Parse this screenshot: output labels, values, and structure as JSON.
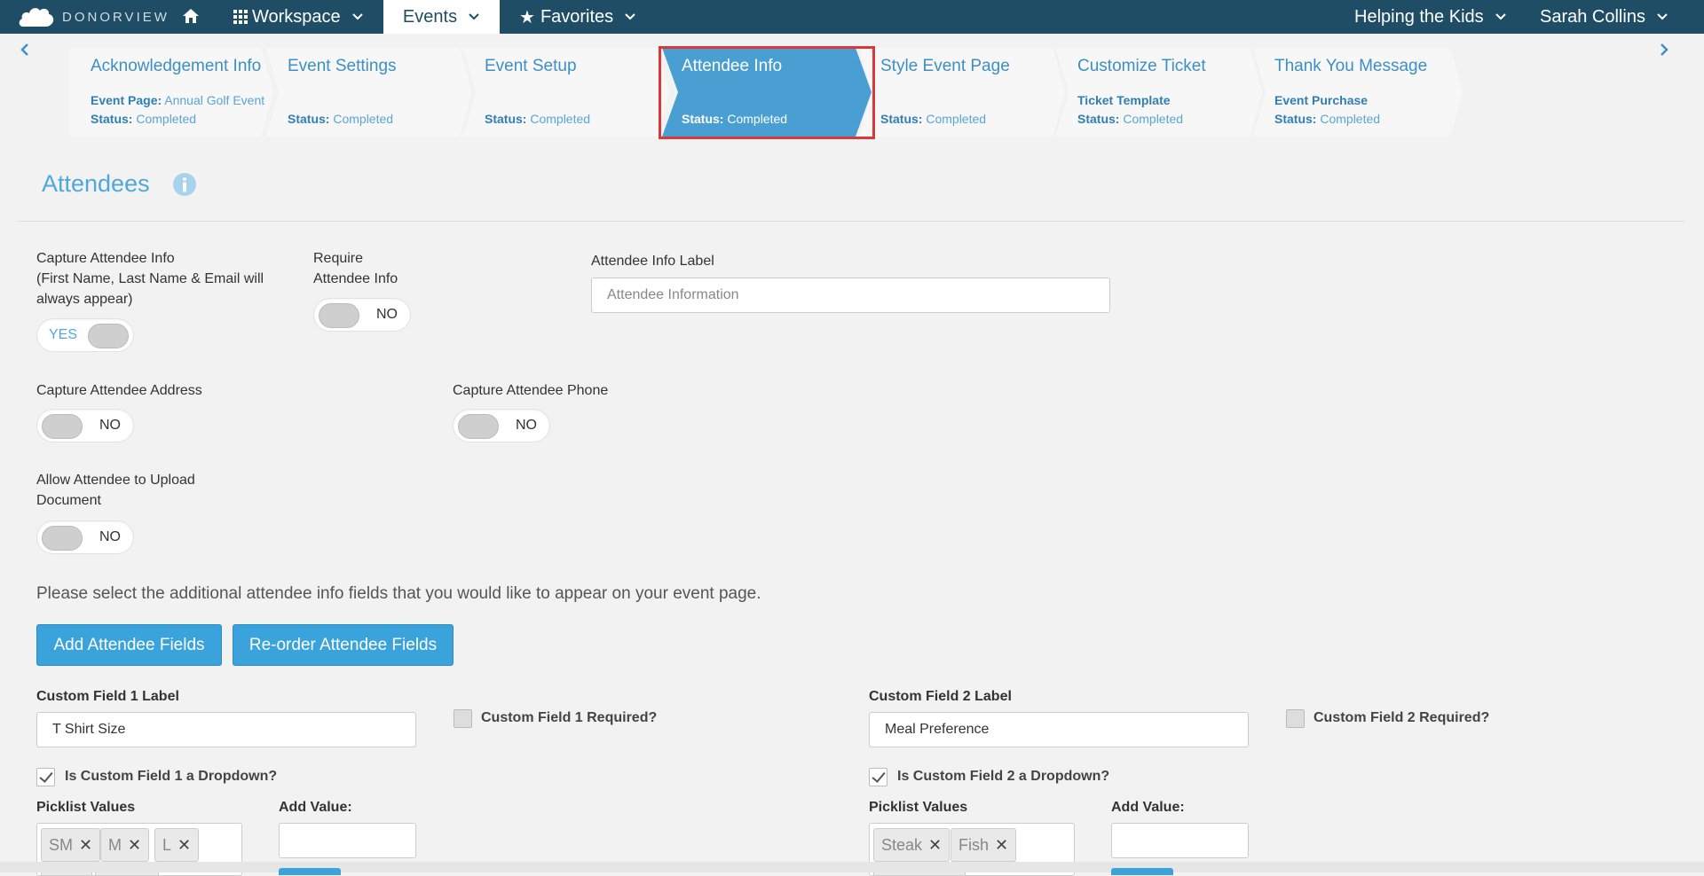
{
  "nav": {
    "logo_text": "DONORVIEW",
    "workspace": "Workspace",
    "events": "Events",
    "favorites": "Favorites",
    "org": "Helping the Kids",
    "user": "Sarah Collins",
    "accent": "#1f4d66"
  },
  "steps": [
    {
      "title": "Acknowledgement Info",
      "line1_key": "Event Page:",
      "line1_val": "Annual Golf Event",
      "line2_key": "Status:",
      "line2_val": "Completed"
    },
    {
      "title": "Event Settings",
      "line2_key": "Status:",
      "line2_val": "Completed"
    },
    {
      "title": "Event Setup",
      "line2_key": "Status:",
      "line2_val": "Completed"
    },
    {
      "title": "Attendee Info",
      "line2_key": "Status:",
      "line2_val": "Completed",
      "active": true
    },
    {
      "title": "Style Event Page",
      "line2_key": "Status:",
      "line2_val": "Completed"
    },
    {
      "title": "Customize Ticket",
      "line1_key": "Ticket Template",
      "line2_key": "Status:",
      "line2_val": "Completed"
    },
    {
      "title": "Thank You Message",
      "line1_key": "Event Purchase",
      "line2_key": "Status:",
      "line2_val": "Completed"
    }
  ],
  "page": {
    "title": "Attendees"
  },
  "form": {
    "capture_info": {
      "label1": "Capture Attendee Info",
      "label2": "(First Name, Last Name & Email will",
      "label3": "always appear)",
      "toggle": "YES"
    },
    "require_info": {
      "label1": "Require",
      "label2": "Attendee Info",
      "toggle": "NO"
    },
    "info_label": {
      "label": "Attendee Info Label",
      "placeholder": "Attendee Information"
    },
    "capture_address": {
      "label": "Capture Attendee Address",
      "toggle": "NO"
    },
    "capture_phone": {
      "label": "Capture Attendee Phone",
      "toggle": "NO"
    },
    "upload_doc": {
      "label1": "Allow Attendee to Upload",
      "label2": "Document",
      "toggle": "NO"
    },
    "instructions": "Please select the additional attendee info fields that you would like to appear on your event page.",
    "add_fields_btn": "Add Attendee Fields",
    "reorder_btn": "Re-order Attendee Fields",
    "custom1": {
      "label": "Custom Field 1 Label",
      "value": "T Shirt Size",
      "required_label": "Custom Field 1 Required?",
      "dropdown_label": "Is Custom Field 1 a Dropdown?",
      "picklist_label": "Picklist Values",
      "add_value_label": "Add Value:",
      "values": [
        "SM",
        "M",
        "L"
      ]
    },
    "custom2": {
      "label": "Custom Field 2 Label",
      "value": "Meal Preference",
      "required_label": "Custom Field 2 Required?",
      "dropdown_label": "Is Custom Field 2 a Dropdown?",
      "picklist_label": "Picklist Values",
      "add_value_label": "Add Value:",
      "values": [
        "Steak",
        "Fish"
      ]
    }
  }
}
